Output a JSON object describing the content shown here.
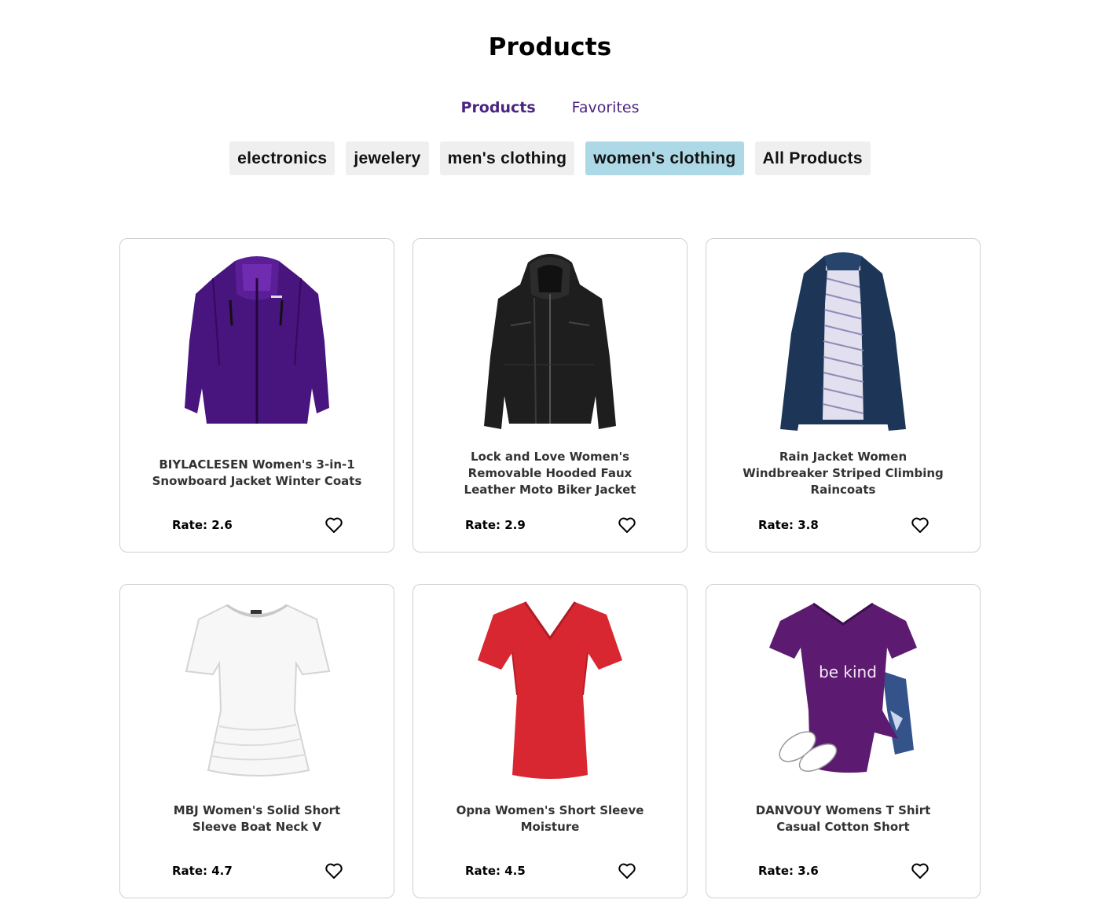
{
  "header": {
    "title": "Products"
  },
  "tabs": [
    {
      "label": "Products",
      "active": true
    },
    {
      "label": "Favorites",
      "active": false
    }
  ],
  "filters": [
    {
      "label": "electronics",
      "active": false
    },
    {
      "label": "jewelery",
      "active": false
    },
    {
      "label": "men's clothing",
      "active": false
    },
    {
      "label": "women's clothing",
      "active": true
    },
    {
      "label": "All Products",
      "active": false
    }
  ],
  "colors": {
    "accent": "#4b2480",
    "active_filter": "#add8e6",
    "filter_bg": "#efefef"
  },
  "products": [
    {
      "title": "BIYLACLESEN Women's 3-in-1 Snowboard Jacket Winter Coats",
      "rate": "Rate: 2.6",
      "image": "purple-jacket",
      "favorite_icon": "heart-outline-icon"
    },
    {
      "title": "Lock and Love Women's Removable Hooded Faux Leather Moto Biker Jacket",
      "rate": "Rate: 2.9",
      "image": "black-leather-jacket",
      "favorite_icon": "heart-outline-icon"
    },
    {
      "title": "Rain Jacket Women Windbreaker Striped Climbing Raincoats",
      "rate": "Rate: 3.8",
      "image": "navy-raincoat",
      "favorite_icon": "heart-outline-icon"
    },
    {
      "title": "MBJ Women's Solid Short Sleeve Boat Neck V",
      "rate": "Rate: 4.7",
      "image": "white-tshirt",
      "favorite_icon": "heart-outline-icon"
    },
    {
      "title": "Opna Women's Short Sleeve Moisture",
      "rate": "Rate: 4.5",
      "image": "red-tshirt",
      "favorite_icon": "heart-outline-icon"
    },
    {
      "title": "DANVOUY Womens T Shirt Casual Cotton Short",
      "rate": "Rate: 3.6",
      "image": "purple-be-kind-tshirt",
      "favorite_icon": "heart-outline-icon",
      "image_text": "be kind"
    }
  ]
}
